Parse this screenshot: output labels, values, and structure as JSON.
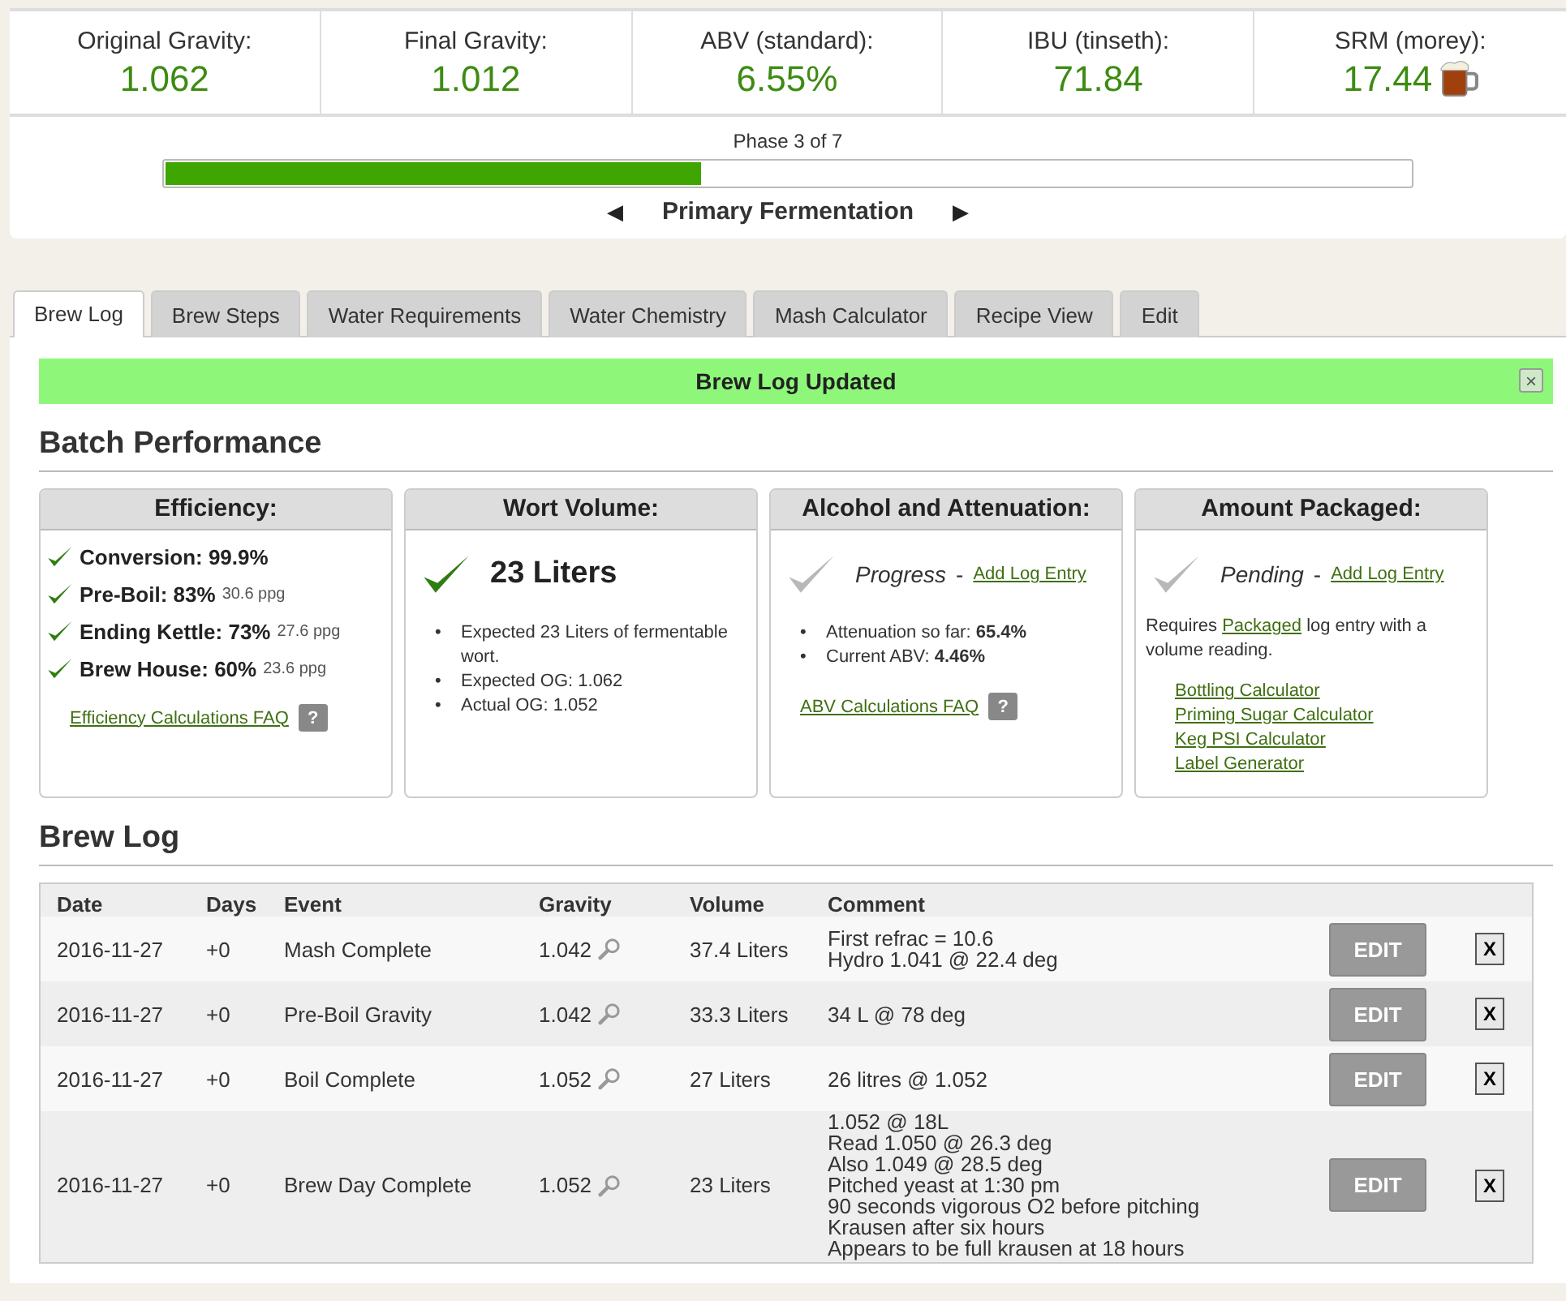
{
  "stats": [
    {
      "label": "Original Gravity:",
      "value": "1.062"
    },
    {
      "label": "Final Gravity:",
      "value": "1.012"
    },
    {
      "label": "ABV (standard):",
      "value": "6.55%"
    },
    {
      "label": "IBU (tinseth):",
      "value": "71.84"
    },
    {
      "label": "SRM (morey):",
      "value": "17.44",
      "color": "#a0400c"
    }
  ],
  "phase": {
    "text": "Phase 3 of 7",
    "level": 0.43,
    "prev": "◀",
    "name": "Primary Fermentation",
    "next": "▶"
  },
  "tabs": [
    {
      "label": "Brew Log",
      "selected": true
    },
    {
      "label": "Brew Steps",
      "selected": false
    },
    {
      "label": "Water Requirements",
      "selected": false
    },
    {
      "label": "Water Chemistry",
      "selected": false
    },
    {
      "label": "Mash Calculator",
      "selected": false
    },
    {
      "label": "Recipe View",
      "selected": false
    },
    {
      "label": "Edit",
      "selected": false
    }
  ],
  "notice": {
    "text": "Brew Log Updated",
    "close": "×"
  },
  "performance": {
    "title": "Batch Performance",
    "cards": [
      {
        "kind": "checklist",
        "title": "Efficiency:",
        "items": [
          {
            "text": "Conversion: 99.9%",
            "done": true
          },
          {
            "text": "Pre-Boil: 83%",
            "note": "30.6 ppg",
            "done": true
          },
          {
            "text": "Ending Kettle: 73%",
            "note": "27.6 ppg",
            "done": true
          },
          {
            "text": "Brew House: 60%",
            "note": "23.6 ppg",
            "done": true
          }
        ],
        "faq": "Efficiency Calculations FAQ",
        "help": "?"
      },
      {
        "kind": "headline",
        "title": "Wort Volume:",
        "done": true,
        "marker": "•",
        "headline": "23 Liters",
        "bullets": [
          "Expected 23 Liters of fermentable wort.",
          "Expected OG: 1.062",
          "Actual OG: 1.052"
        ]
      },
      {
        "kind": "status",
        "title": "Alcohol and Attenuation:",
        "done": false,
        "status": "Progress",
        "separator": "-",
        "link": "Add Log Entry",
        "marker": "•",
        "bullets": [
          "Attenuation so far: **65.4%**",
          "Current ABV: **4.46%**"
        ],
        "faq": "ABV Calculations FAQ",
        "help": "?"
      },
      {
        "kind": "status",
        "title": "Amount Packaged:",
        "done": false,
        "status": "Pending",
        "separator": "-",
        "link": "Add Log Entry",
        "note": {
          "before": "Requires ",
          "link": "Packaged",
          "after": " log entry with a volume reading."
        },
        "links": [
          "Bottling Calculator",
          "Priming Sugar Calculator",
          "Keg PSI Calculator",
          "Label Generator"
        ]
      }
    ]
  },
  "brew_log": {
    "title": "Brew Log",
    "columns": [
      "Date",
      "Days",
      "Event",
      "Gravity",
      "Volume",
      "Comment"
    ],
    "rows": [
      {
        "date": "2016-11-27",
        "days": "+0",
        "event": "Mash Complete",
        "gravity": "1.042",
        "volume": "37.4 Liters",
        "comment": [
          "First refrac = 10.6",
          "Hydro 1.041 @ 22.4 deg"
        ],
        "edit": "EDIT",
        "delete": "X"
      },
      {
        "date": "2016-11-27",
        "days": "+0",
        "event": "Pre-Boil Gravity",
        "gravity": "1.042",
        "volume": "33.3 Liters",
        "comment": [
          "34 L @ 78 deg"
        ],
        "edit": "EDIT",
        "delete": "X"
      },
      {
        "date": "2016-11-27",
        "days": "+0",
        "event": "Boil Complete",
        "gravity": "1.052",
        "volume": "27 Liters",
        "comment": [
          "26 litres @ 1.052"
        ],
        "edit": "EDIT",
        "delete": "X"
      },
      {
        "date": "2016-11-27",
        "days": "+0",
        "event": "Brew Day Complete",
        "gravity": "1.052",
        "volume": "23 Liters",
        "comment": [
          "1.052 @ 18L",
          "Read 1.050 @ 26.3 deg",
          "Also 1.049 @ 28.5 deg",
          "Pitched yeast at 1:30 pm",
          "90 seconds vigorous O2 before pitching",
          "Krausen after six hours",
          "Appears to be full krausen at 18 hours"
        ],
        "edit": "EDIT",
        "delete": "X"
      }
    ]
  }
}
